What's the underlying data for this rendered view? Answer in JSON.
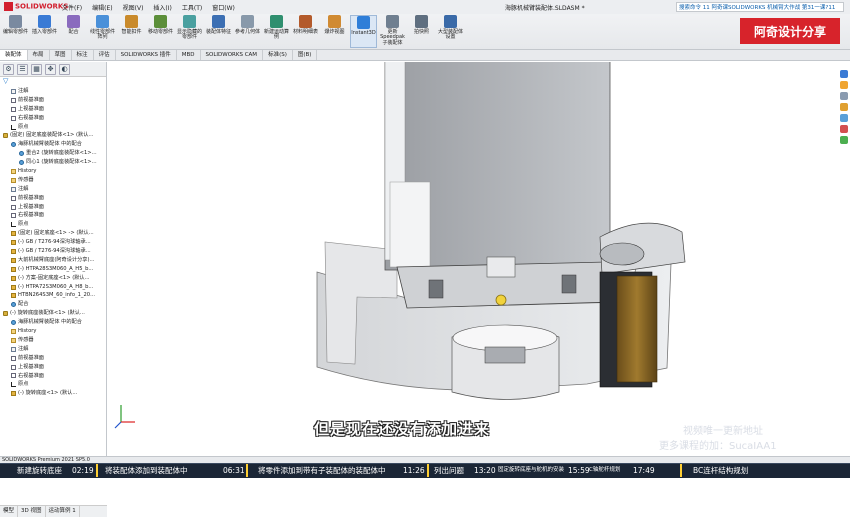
{
  "app": {
    "logo_text": "SOLIDWORKS",
    "menu": [
      "文件(F)",
      "编辑(E)",
      "视图(V)",
      "插入(I)",
      "工具(T)",
      "窗口(W)"
    ],
    "document_title": "海豚机械臂装配体.SLDASM *",
    "search_text": "搜索命令 11 阿奇课SOLIDWORKS 机械臂大作战 第31一课?11"
  },
  "brand_badge": "阿奇设计分享",
  "ribbon_tools": [
    {
      "label": "编辑零部件",
      "color": "#7a8aa0"
    },
    {
      "label": "插入零部件",
      "color": "#3a7bd5"
    },
    {
      "label": "配合",
      "color": "#8a6bbe"
    },
    {
      "label": "线性零部件阵列",
      "color": "#4a90d9"
    },
    {
      "label": "智能扣件",
      "color": "#c98a2b"
    },
    {
      "label": "移动零部件",
      "color": "#5c8f3a"
    },
    {
      "label": "显示隐藏的零部件",
      "color": "#4aa0a0"
    },
    {
      "label": "装配体特征",
      "color": "#3c6fb3"
    },
    {
      "label": "参考几何体",
      "color": "#8899aa"
    },
    {
      "label": "新建运动算例",
      "color": "#2f8f6f"
    },
    {
      "label": "材料明细表",
      "color": "#b35a2b"
    },
    {
      "label": "爆炸视图",
      "color": "#d08a32"
    },
    {
      "label": "Instant3D",
      "color": "#2f7ed8",
      "active": true
    },
    {
      "label": "更新Speedpak子装配体",
      "color": "#6f7f90"
    },
    {
      "label": "拍快照",
      "color": "#5f6f80"
    },
    {
      "label": "大型装配体设置",
      "color": "#3a6aa8"
    }
  ],
  "command_tabs": [
    "装配体",
    "布局",
    "草图",
    "标注",
    "评估",
    "SOLIDWORKS 插件",
    "MBD",
    "SOLIDWORKS CAM",
    "标准(S)",
    "图(B)"
  ],
  "left_panel": {
    "tab_icons": [
      "⚙",
      "☰",
      "▦",
      "✥",
      "◐"
    ],
    "filter_icon": "filter-icon",
    "tree": [
      {
        "text": "注解",
        "icon": "note",
        "indent": 1
      },
      {
        "text": "前视基准面",
        "icon": "plane",
        "indent": 1
      },
      {
        "text": "上视基准面",
        "icon": "plane",
        "indent": 1
      },
      {
        "text": "右视基准面",
        "icon": "plane",
        "indent": 1
      },
      {
        "text": "原点",
        "icon": "orig",
        "indent": 1
      },
      {
        "text": "(固定) 固定底座装配体<1> (默认...",
        "icon": "asm",
        "indent": 0
      },
      {
        "text": "海豚机械臂装配体 中的配合",
        "icon": "mate",
        "indent": 1
      },
      {
        "text": "重合2 (旋转底座装配体<1>...",
        "icon": "mate",
        "indent": 2
      },
      {
        "text": "同心1 (旋转底座装配体<1>...",
        "icon": "mate",
        "indent": 2
      },
      {
        "text": "History",
        "icon": "fold",
        "indent": 1
      },
      {
        "text": "传感器",
        "icon": "fold",
        "indent": 1
      },
      {
        "text": "注解",
        "icon": "note",
        "indent": 1
      },
      {
        "text": "前视基准面",
        "icon": "plane",
        "indent": 1
      },
      {
        "text": "上视基准面",
        "icon": "plane",
        "indent": 1
      },
      {
        "text": "右视基准面",
        "icon": "plane",
        "indent": 1
      },
      {
        "text": "原点",
        "icon": "orig",
        "indent": 1
      },
      {
        "text": "(固定) 固定底座<1> -> (默认...",
        "icon": "part",
        "indent": 1
      },
      {
        "text": "(-) GB / T276-94深沟球轴承...",
        "icon": "part",
        "indent": 1
      },
      {
        "text": "(-) GB / T276-94深沟球轴承...",
        "icon": "part",
        "indent": 1
      },
      {
        "text": "大前机械臂底座(阿奇设计分享)...",
        "icon": "part",
        "indent": 1
      },
      {
        "text": "(-) HTPA28S3M060_A_H5_b...",
        "icon": "part",
        "indent": 1
      },
      {
        "text": "(-) 方案-固定底座<1> (默认...",
        "icon": "part",
        "indent": 1
      },
      {
        "text": "(-) HTPA72S3M060_A_H8_b...",
        "icon": "part",
        "indent": 1
      },
      {
        "text": "HTBN264S3M_60_info_1_20...",
        "icon": "part",
        "indent": 1
      },
      {
        "text": "配合",
        "icon": "mate",
        "indent": 1
      },
      {
        "text": "(-) 旋转底座装配体<1> (默认...",
        "icon": "asm",
        "indent": 0
      },
      {
        "text": "海豚机械臂装配体 中的配合",
        "icon": "mate",
        "indent": 1
      },
      {
        "text": "History",
        "icon": "fold",
        "indent": 1
      },
      {
        "text": "传感器",
        "icon": "fold",
        "indent": 1
      },
      {
        "text": "注解",
        "icon": "note",
        "indent": 1
      },
      {
        "text": "前视基准面",
        "icon": "plane",
        "indent": 1
      },
      {
        "text": "上视基准面",
        "icon": "plane",
        "indent": 1
      },
      {
        "text": "右视基准面",
        "icon": "plane",
        "indent": 1
      },
      {
        "text": "原点",
        "icon": "orig",
        "indent": 1
      },
      {
        "text": "(-) 旋转底座<1> (默认...",
        "icon": "part",
        "indent": 1
      }
    ],
    "bottom_tabs": [
      "模型",
      "3D 视图",
      "运动算例 1"
    ]
  },
  "viewport": {
    "subtitle": "但是现在还没有添加进来",
    "watermark_lines": [
      "视频唯一更新地址",
      "更多课程的加：SucaIAA1"
    ]
  },
  "status_text": "SOLIDWORKS Premium 2021 SP5.0",
  "timeline": [
    {
      "title": "新建旋转底座",
      "time": "02:19"
    },
    {
      "title": "将装配体添加到装配体中",
      "time": "06:31"
    },
    {
      "title": "将零件添加到带有子装配体的装配体中",
      "time": "11:26"
    },
    {
      "title": "列出问题",
      "time": "13:20"
    },
    {
      "title": "固定旋转底座与舵机的安装",
      "time": "15:59"
    },
    {
      "title": "C轴舵杆规划",
      "time": "17:49"
    },
    {
      "title": "BC连杆结构规划",
      "time": ""
    }
  ]
}
